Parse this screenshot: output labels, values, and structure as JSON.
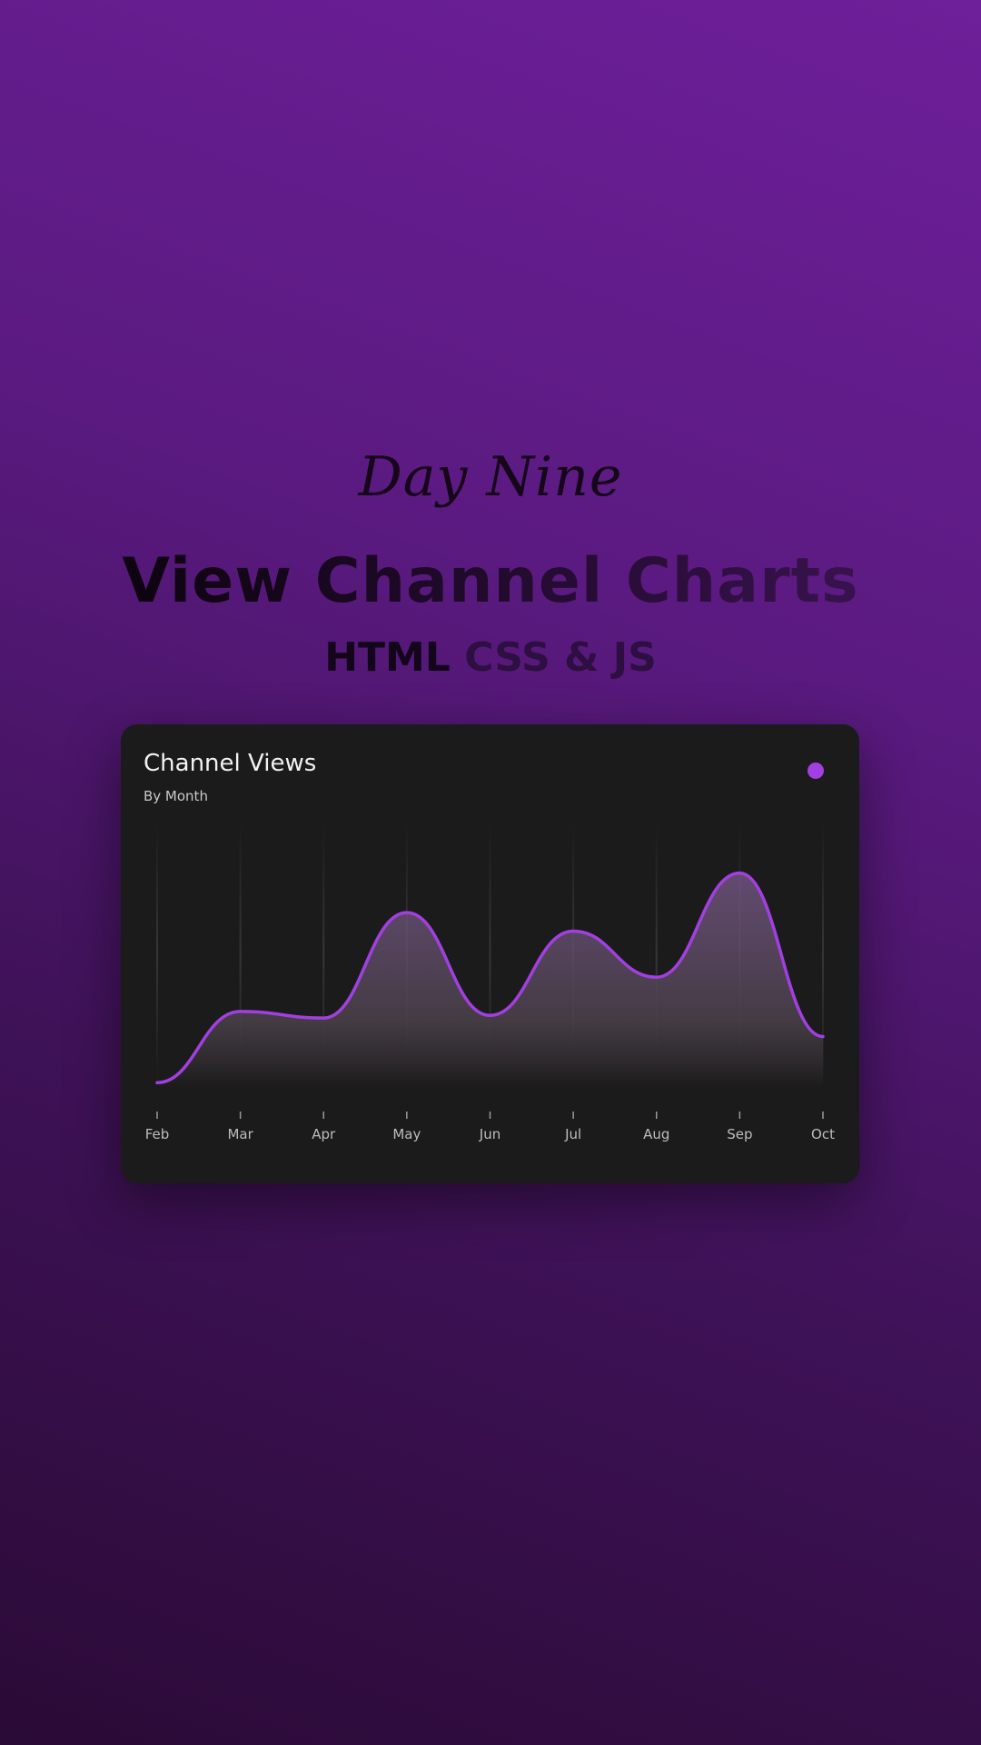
{
  "header": {
    "day_label": "Day Nine",
    "headline": "View Channel Charts",
    "subline_part1": "HTML",
    "subline_part2": "CSS & JS"
  },
  "card": {
    "title": "Channel Views",
    "subtitle": "By Month"
  },
  "colors": {
    "accent": "#a23fe0",
    "card_bg": "#1b1b1b"
  },
  "chart_data": {
    "type": "area",
    "categories": [
      "Feb",
      "Mar",
      "Apr",
      "May",
      "Jun",
      "Jul",
      "Aug",
      "Sep",
      "Oct"
    ],
    "values": [
      4,
      58,
      53,
      133,
      55,
      119,
      84,
      163,
      39
    ],
    "ylim": [
      0,
      200
    ],
    "grid": "vertical",
    "legend": "top-right"
  }
}
